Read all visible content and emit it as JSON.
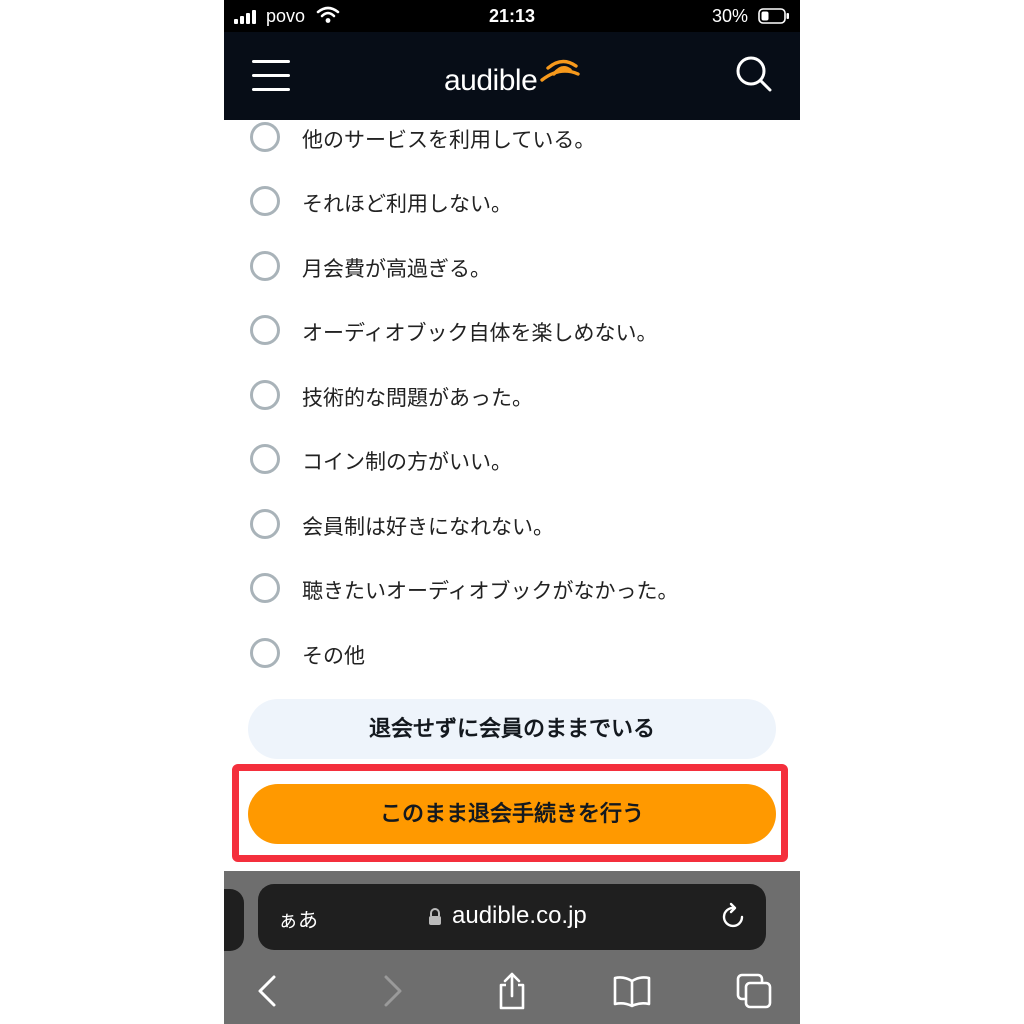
{
  "status_bar": {
    "carrier": "povo",
    "time": "21:13",
    "battery": "30%"
  },
  "header": {
    "logo_text": "audible",
    "menu_icon": "hamburger-menu-icon",
    "search_icon": "search-icon",
    "colors": {
      "background": "#070d17",
      "logo_accent": "#f7991c"
    }
  },
  "reasons": [
    {
      "label": "他のサービスを利用している。"
    },
    {
      "label": "それほど利用しない。"
    },
    {
      "label": "月会費が高過ぎる。"
    },
    {
      "label": "オーディオブック自体を楽しめない。"
    },
    {
      "label": "技術的な問題があった。"
    },
    {
      "label": "コイン制の方がいい。"
    },
    {
      "label": "会員制は好きになれない。"
    },
    {
      "label": "聴きたいオーディオブックがなかった。"
    },
    {
      "label": "その他"
    }
  ],
  "actions": {
    "stay_label": "退会せずに会員のままでいる",
    "cancel_label": "このまま退会手続きを行う",
    "colors": {
      "stay": "#eef4fb",
      "cancel": "#ff9900",
      "highlight": "#f42f3c"
    }
  },
  "browser": {
    "text_size_label": "ぁあ",
    "url": "audible.co.jp",
    "icons": [
      "back-icon",
      "forward-icon",
      "share-icon",
      "bookmarks-icon",
      "tabs-icon",
      "reload-icon",
      "lock-icon"
    ]
  }
}
